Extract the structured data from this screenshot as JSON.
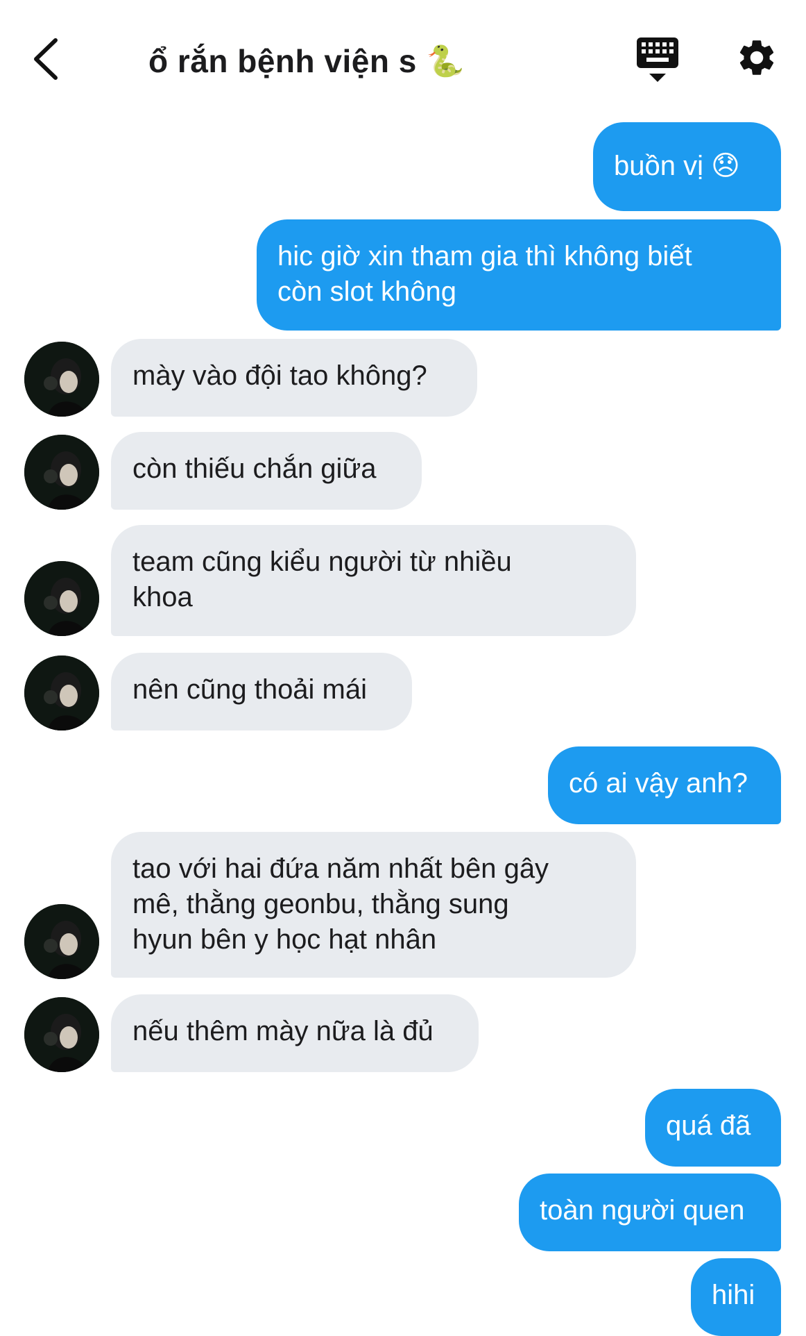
{
  "header": {
    "title": "ổ rắn bệnh viện s",
    "title_emoji": "🐍",
    "back_icon": "chevron-left-icon",
    "keyboard_icon": "keyboard-icon",
    "settings_icon": "gear-icon"
  },
  "colors": {
    "outgoing_bubble": "#1d9bf0",
    "incoming_bubble": "#e8ebef",
    "text_dark": "#1c1c1e"
  },
  "messages": [
    {
      "sender": "me",
      "text": "buồn vị 😞"
    },
    {
      "sender": "me",
      "text": "hic giờ xin tham gia thì không biết\ncòn slot không"
    },
    {
      "sender": "other",
      "text": "mày vào đội tao không?"
    },
    {
      "sender": "other",
      "text": "còn thiếu chắn giữa"
    },
    {
      "sender": "other",
      "text": "team cũng kiểu người từ nhiều\nkhoa"
    },
    {
      "sender": "other",
      "text": "nên cũng thoải mái"
    },
    {
      "sender": "me",
      "text": "có ai vậy anh?"
    },
    {
      "sender": "other",
      "text": "tao với hai đứa năm nhất bên gây\nmê, thằng geonbu, thằng sung\nhyun bên y học hạt nhân"
    },
    {
      "sender": "other",
      "text": "nếu thêm mày nữa là đủ"
    },
    {
      "sender": "me",
      "text": "quá đã"
    },
    {
      "sender": "me",
      "text": "toàn người quen"
    },
    {
      "sender": "me",
      "text": "hihi"
    }
  ]
}
